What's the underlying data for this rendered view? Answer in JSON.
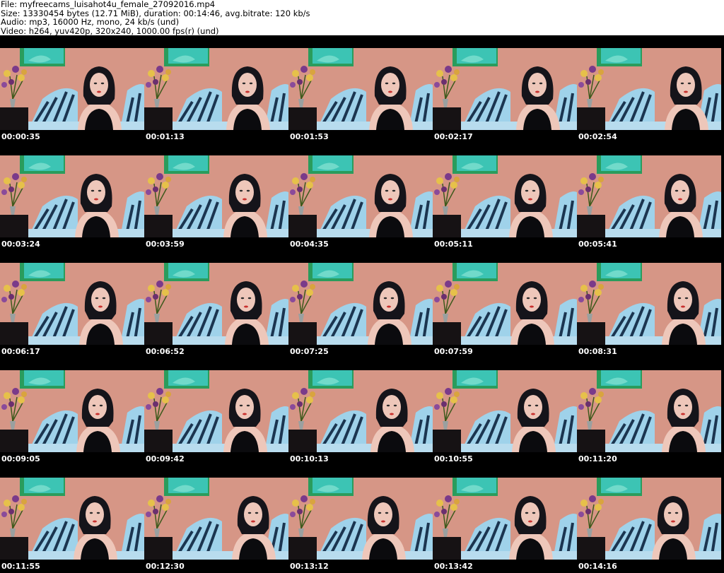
{
  "header": {
    "file_line": "File: myfreecams_luisahot4u_female_27092016.mp4",
    "size_line": "Size: 13330454 bytes (12.71 MiB), duration: 00:14:46, avg.bitrate: 120 kb/s",
    "audio_line": "Audio: mp3, 16000 Hz, mono, 24 kb/s (und)",
    "video_line": "Video: h264, yuv420p, 320x240, 1000.00 fps(r) (und)"
  },
  "colors": {
    "wall": "#d69686",
    "art_teal": "#3cc4b4",
    "art_green": "#2a9c5c",
    "blanket_light": "#9fd2ea",
    "blanket_dark": "#1b3550",
    "hair": "#15141a",
    "skin": "#eec7ba",
    "top": "#0b0b0e",
    "table": "#161214"
  },
  "thumbnails": [
    {
      "timestamp": "00:00:35"
    },
    {
      "timestamp": "00:01:13"
    },
    {
      "timestamp": "00:01:53"
    },
    {
      "timestamp": "00:02:17"
    },
    {
      "timestamp": "00:02:54"
    },
    {
      "timestamp": "00:03:24"
    },
    {
      "timestamp": "00:03:59"
    },
    {
      "timestamp": "00:04:35"
    },
    {
      "timestamp": "00:05:11"
    },
    {
      "timestamp": "00:05:41"
    },
    {
      "timestamp": "00:06:17"
    },
    {
      "timestamp": "00:06:52"
    },
    {
      "timestamp": "00:07:25"
    },
    {
      "timestamp": "00:07:59"
    },
    {
      "timestamp": "00:08:31"
    },
    {
      "timestamp": "00:09:05"
    },
    {
      "timestamp": "00:09:42"
    },
    {
      "timestamp": "00:10:13"
    },
    {
      "timestamp": "00:10:55"
    },
    {
      "timestamp": "00:11:20"
    },
    {
      "timestamp": "00:11:55"
    },
    {
      "timestamp": "00:12:30"
    },
    {
      "timestamp": "00:13:12"
    },
    {
      "timestamp": "00:13:42"
    },
    {
      "timestamp": "00:14:16"
    }
  ]
}
